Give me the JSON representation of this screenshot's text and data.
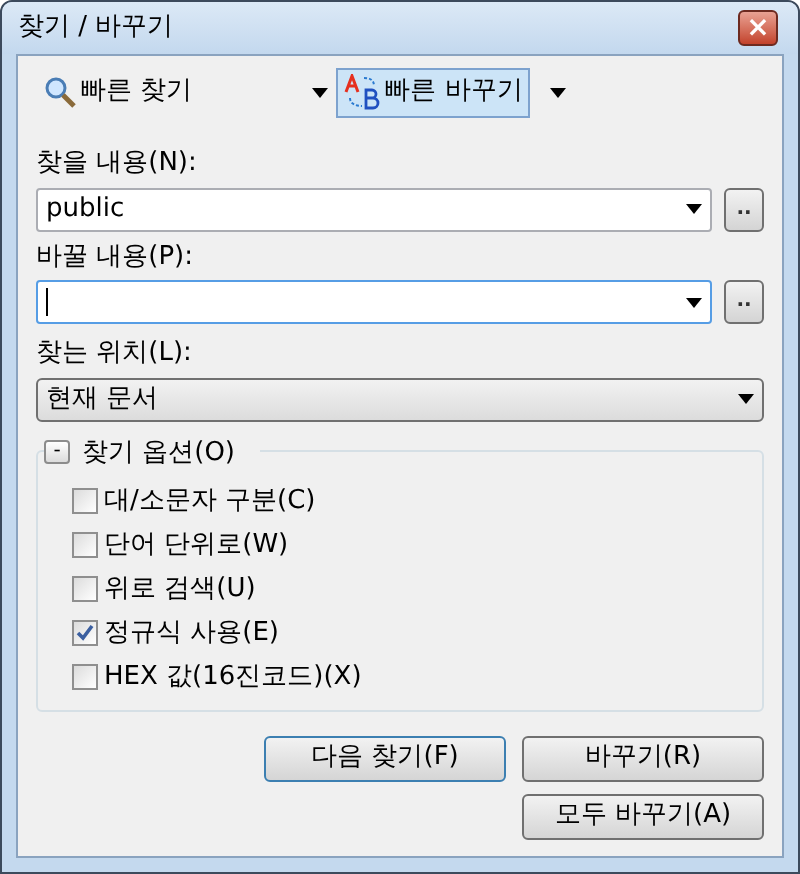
{
  "window": {
    "title": "찾기 / 바꾸기",
    "close": "×"
  },
  "modes": [
    {
      "label": "빠른 찾기",
      "kind": "find",
      "selected": false
    },
    {
      "label": "빠른 바꾸기",
      "kind": "replace",
      "selected": true
    }
  ],
  "find_field": {
    "label": "찾을 내용(N):",
    "value": "public",
    "browse": ".."
  },
  "replace_field": {
    "label": "바꿀 내용(P):",
    "focused": true,
    "browse": ".."
  },
  "look_in": {
    "label": "찾는 위치(L):",
    "value": "현재 문서"
  },
  "options": {
    "toggle": "-",
    "title": "찾기 옵션(O)",
    "expanded": true,
    "items": [
      {
        "label": "대/소문자 구분(C)",
        "checked": false
      },
      {
        "label": "단어 단위로(W)",
        "checked": false
      },
      {
        "label": "위로 검색(U)",
        "checked": false
      },
      {
        "label": "정규식 사용(E)",
        "checked": true
      },
      {
        "label": "HEX 값(16진코드)(X)",
        "checked": false
      }
    ]
  },
  "buttons": [
    {
      "label": "다음 찾기(F)",
      "default": true
    },
    {
      "label": "바꾸기(R)",
      "default": false
    },
    {
      "label": "모두 바꾸기(A)",
      "default": false
    }
  ]
}
